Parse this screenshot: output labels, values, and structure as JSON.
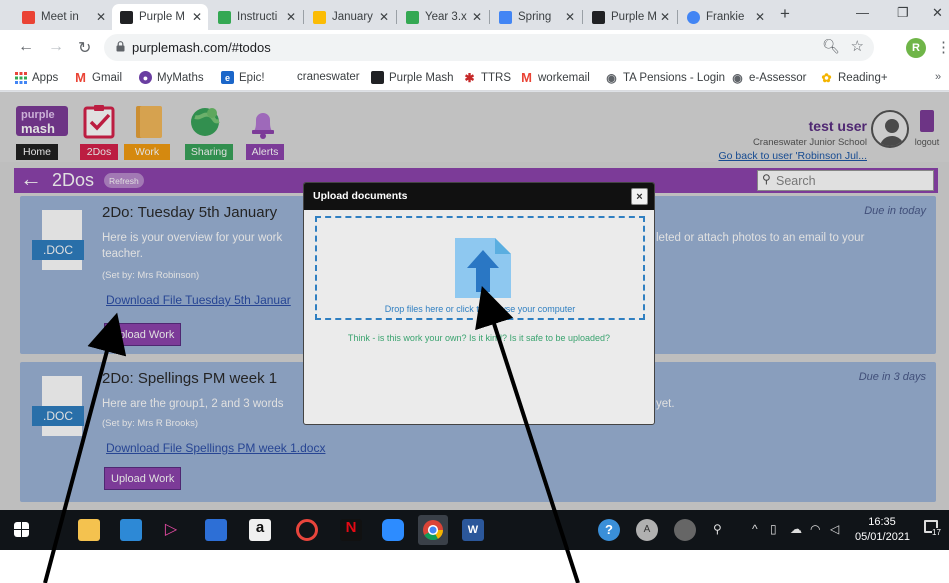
{
  "browser": {
    "tabs": [
      {
        "label": "Meet in",
        "favicon_color": "#ea4335",
        "active": false
      },
      {
        "label": "Purple M",
        "favicon_color": "#202124",
        "active": true
      },
      {
        "label": "Instructi",
        "favicon_color": "#34a853",
        "active": false
      },
      {
        "label": "January",
        "favicon_color": "#fbbc05",
        "active": false
      },
      {
        "label": "Year 3.x",
        "favicon_color": "#34a853",
        "active": false
      },
      {
        "label": "Spring",
        "favicon_color": "#4285f4",
        "active": false
      },
      {
        "label": "Purple M",
        "favicon_color": "#202124",
        "active": false
      },
      {
        "label": "Frankie",
        "favicon_color": "#4285f4",
        "active": false
      }
    ],
    "new_tab": "+",
    "url": "purplemash.com/#todos",
    "profile_initial": "R",
    "bookmarks": [
      {
        "label": "Apps",
        "icon": "apps-grid-icon",
        "color": "#e8453c"
      },
      {
        "label": "Gmail",
        "icon": "gmail-icon",
        "color": "#ea4335"
      },
      {
        "label": "MyMaths",
        "icon": "mymaths-icon",
        "color": "#6a3ea1"
      },
      {
        "label": "Epic!",
        "icon": "epic-icon",
        "color": "#1b66c9"
      },
      {
        "label": "craneswater",
        "icon": "",
        "color": ""
      },
      {
        "label": "Purple Mash",
        "icon": "purplemash-icon",
        "color": "#202124"
      },
      {
        "label": "TTRS",
        "icon": "ttrs-icon",
        "color": "#c62828"
      },
      {
        "label": "workemail",
        "icon": "gmail-icon",
        "color": "#ea4335"
      },
      {
        "label": "TA Pensions - Login",
        "icon": "globe-icon",
        "color": "#5f6368"
      },
      {
        "label": "e-Assessor",
        "icon": "globe-icon",
        "color": "#5f6368"
      },
      {
        "label": "Reading+",
        "icon": "reading-icon",
        "color": "#f4b400"
      }
    ],
    "bookmarks_more": "»"
  },
  "purplemash": {
    "logo_line1": "purple",
    "logo_line2": "mash",
    "nav_tabs": [
      {
        "label": "Home",
        "color": "#222222"
      },
      {
        "label": "2Dos",
        "color": "#d6224a"
      },
      {
        "label": "Work",
        "color": "#f39c12"
      },
      {
        "label": "Sharing",
        "color": "#3aa35a"
      },
      {
        "label": "Alerts",
        "color": "#8e44ad"
      }
    ],
    "user_name": "test user",
    "school": "Craneswater Junior School",
    "go_back": "Go back to user 'Robinson Jul...",
    "logout": "logout",
    "section_title": "2Dos",
    "refresh": "Refresh",
    "search_placeholder": "Search",
    "todos": [
      {
        "title": "2Do: Tuesday 5th January",
        "due": "Due in today",
        "file_type": ".DOC",
        "desc_left": "Here is your overview for your work",
        "desc_left2": "teacher.",
        "desc_right": "leted or attach photos to an email to your",
        "set_by": "(Set by: Mrs Robinson)",
        "file_link": "Download File Tuesday 5th Januar",
        "button": "Upload Work"
      },
      {
        "title": "2Do: Spellings PM week 1",
        "due": "Due in 3 days",
        "file_type": ".DOC",
        "desc_left": "Here are the group1, 2 and 3 words",
        "desc_left2": "",
        "desc_right": "yet.",
        "set_by": "(Set by: Mrs R Brooks)",
        "file_link": "Download File Spellings PM week 1.docx",
        "button": "Upload Work"
      }
    ]
  },
  "modal": {
    "title": "Upload documents",
    "close": "×",
    "drop_text": "Drop files here or click to browse your computer",
    "think_text": "Think - is this work your own? Is it kind? Is it safe to be uploaded?"
  },
  "taskbar": {
    "time": "16:35",
    "date": "05/01/2021",
    "notification_count": "17"
  }
}
